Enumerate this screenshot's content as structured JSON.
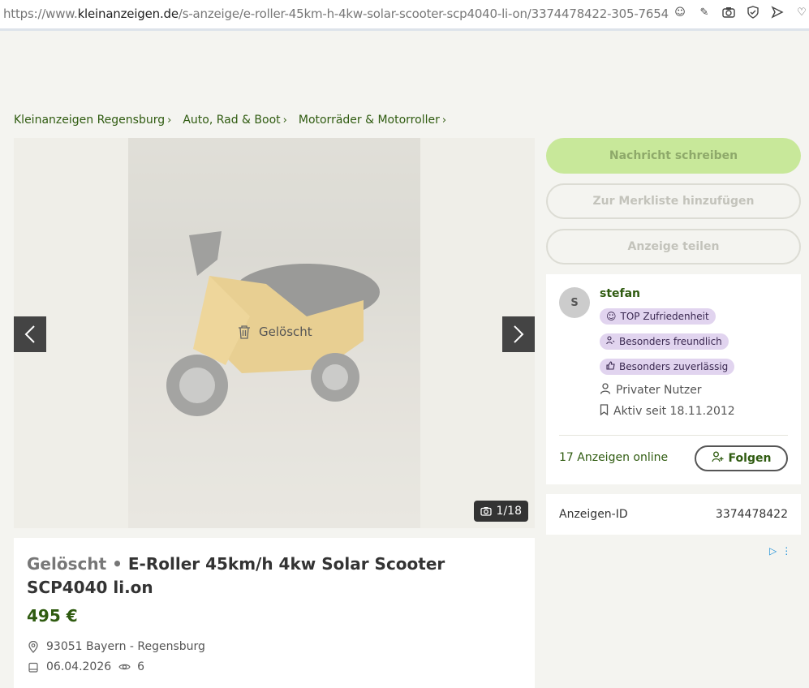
{
  "browser": {
    "url_prefix": "https://www.",
    "url_host": "kleinanzeigen.de",
    "url_path": "/s-anzeige/e-roller-45km-h-4kw-solar-scooter-scp4040-li-on/3374478422-305-7654"
  },
  "breadcrumb": [
    {
      "label": "Kleinanzeigen Regensburg"
    },
    {
      "label": "Auto, Rad & Boot"
    },
    {
      "label": "Motorräder & Motorroller"
    }
  ],
  "gallery": {
    "overlay_label": "Gelöscht",
    "counter": "1/18",
    "prev_icon": "chevron-left-icon",
    "next_icon": "chevron-right-icon"
  },
  "listing": {
    "status": "Gelöscht",
    "separator": "•",
    "title": "E-Roller 45km/h 4kw Solar Scooter SCP4040 li.on",
    "price": "495 €",
    "location": "93051 Bayern - Regensburg",
    "date": "06.04.2026",
    "views": "6"
  },
  "actions": {
    "message": "Nachricht schreiben",
    "watchlist": "Zur Merkliste hinzufügen",
    "share": "Anzeige teilen"
  },
  "seller": {
    "avatar_initial": "S",
    "name": "stefan",
    "badges": [
      "TOP Zufriedenheit",
      "Besonders freundlich",
      "Besonders zuverlässig"
    ],
    "type": "Privater Nutzer",
    "active_since": "Aktiv seit 18.11.2012",
    "ads_online": "17 Anzeigen online",
    "follow_label": "Folgen"
  },
  "ad_id": {
    "label": "Anzeigen-ID",
    "value": "3374478422"
  },
  "colors": {
    "brand_green": "#2f5b10",
    "primary_button": "#c8e89a",
    "badge_bg": "#e1d4ef"
  }
}
